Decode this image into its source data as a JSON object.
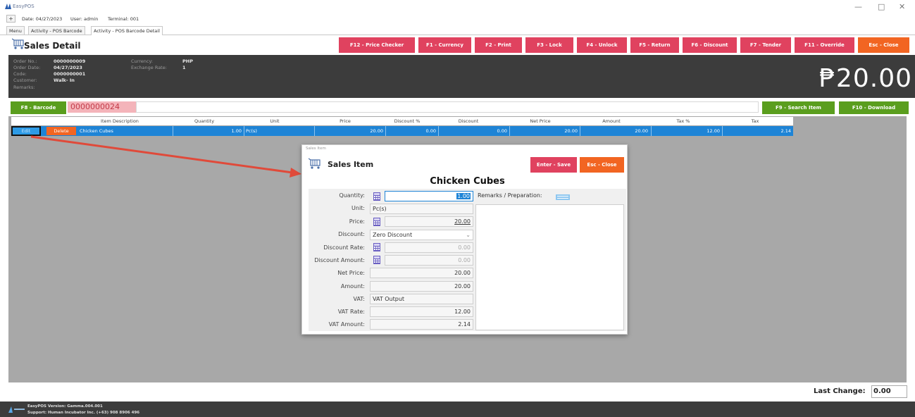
{
  "window": {
    "app_title": "EasyPOS",
    "minimize": "—",
    "maximize": "□",
    "close": "✕"
  },
  "infobar": {
    "plus": "+",
    "date": "Date: 04/27/2023",
    "user": "User: admin",
    "terminal": "Terminal: 001"
  },
  "tabs": [
    {
      "label": "Menu"
    },
    {
      "label": "Activity - POS Barcode"
    },
    {
      "label": "Activity - POS Barcode Detail"
    }
  ],
  "header": {
    "title": "Sales Detail",
    "buttons": [
      {
        "label": "F12 - Price Checker",
        "color": "#e0425f"
      },
      {
        "label": "F1 - Currency",
        "color": "#e0425f"
      },
      {
        "label": "F2 - Print",
        "color": "#e0425f"
      },
      {
        "label": "F3 - Lock",
        "color": "#e0425f"
      },
      {
        "label": "F4 - Unlock",
        "color": "#e0425f"
      },
      {
        "label": "F5 - Return",
        "color": "#e0425f"
      },
      {
        "label": "F6 - Discount",
        "color": "#e0425f"
      },
      {
        "label": "F7 - Tender",
        "color": "#e0425f"
      },
      {
        "label": "F11 - Override",
        "color": "#e0425f"
      },
      {
        "label": "Esc - Close",
        "color": "#f26522"
      }
    ]
  },
  "order_info": {
    "order_no_label": "Order No.:",
    "order_no": "0000000009",
    "order_date_label": "Order Date:",
    "order_date": "04/27/2023",
    "code_label": "Code:",
    "code": "0000000001",
    "customer_label": "Customer:",
    "customer": "Walk- In",
    "remarks_label": "Remarks:",
    "currency_label": "Currency:",
    "currency": "PHP",
    "exchange_rate_label": "Exchange Rate:",
    "exchange_rate": "1",
    "total": "₱20.00"
  },
  "barcode_bar": {
    "barcode_button": "F8 - Barcode",
    "barcode_value": "0000000024",
    "search_button": "F9 - Search Item",
    "download_button": "F10 - Download"
  },
  "grid": {
    "columns": [
      "Item Description",
      "Quantity",
      "Unit",
      "Price",
      "Discount %",
      "Discount",
      "Net Price",
      "Amount",
      "Tax %",
      "Tax"
    ],
    "rows": [
      {
        "edit": "Edit",
        "delete": "Delete",
        "item_description": "Chicken Cubes",
        "quantity": "1.00",
        "unit": "Pc(s)",
        "price": "20.00",
        "discount_pct": "0.00",
        "discount": "0.00",
        "net_price": "20.00",
        "amount": "20.00",
        "tax_pct": "12.00",
        "tax": "2.14"
      }
    ]
  },
  "modal": {
    "window_title": "Sales Item",
    "title": "Sales Item",
    "save_button": "Enter - Save",
    "close_button": "Esc - Close",
    "item_name": "Chicken Cubes",
    "remarks_label": "Remarks / Preparation:",
    "fields": {
      "quantity_label": "Quantity:",
      "quantity": "1.00",
      "unit_label": "Unit:",
      "unit": "Pc(s)",
      "price_label": "Price:",
      "price": "20.00",
      "discount_label": "Discount:",
      "discount": "Zero Discount",
      "discount_rate_label": "Discount Rate:",
      "discount_rate": "0.00",
      "discount_amount_label": "Discount Amount:",
      "discount_amount": "0.00",
      "net_price_label": "Net Price:",
      "net_price": "20.00",
      "amount_label": "Amount:",
      "amount": "20.00",
      "vat_label": "VAT:",
      "vat": "VAT Output",
      "vat_rate_label": "VAT Rate:",
      "vat_rate": "12.00",
      "vat_amount_label": "VAT Amount:",
      "vat_amount": "2.14"
    }
  },
  "footer": {
    "last_change_label": "Last Change:",
    "last_change": "0.00",
    "version": "EasyPOS Version: Gamma.004.001",
    "support": "Support: Human Incubator Inc. (+63) 908 8906 496"
  },
  "colors": {
    "pink": "#e0425f",
    "orange": "#f26522",
    "green": "#5a9e1e",
    "selected_row": "#1e84d6",
    "dark_panel": "#3c3c3c"
  }
}
